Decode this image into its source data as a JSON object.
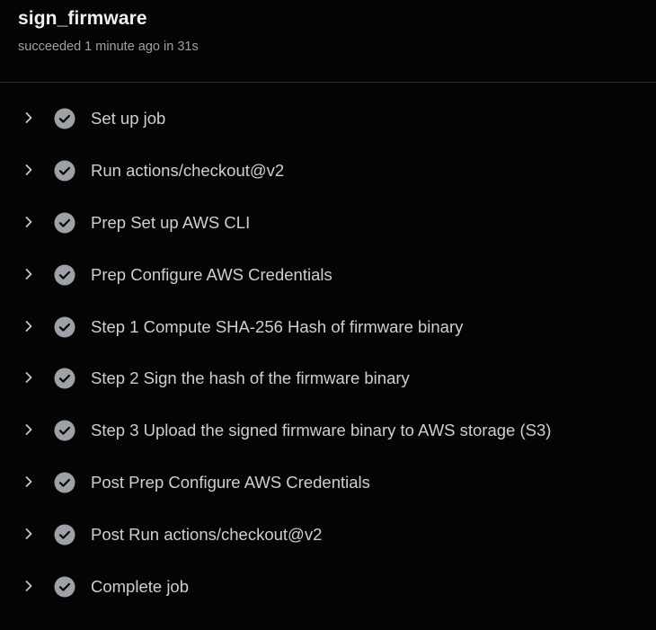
{
  "job": {
    "title": "sign_firmware",
    "status": "succeeded 1 minute ago in 31s"
  },
  "steps": [
    {
      "label": "Set up job",
      "status": "success"
    },
    {
      "label": "Run actions/checkout@v2",
      "status": "success"
    },
    {
      "label": "Prep Set up AWS CLI",
      "status": "success"
    },
    {
      "label": "Prep Configure AWS Credentials",
      "status": "success"
    },
    {
      "label": "Step 1 Compute SHA-256 Hash of firmware binary",
      "status": "success"
    },
    {
      "label": "Step 2 Sign the hash of the firmware binary",
      "status": "success"
    },
    {
      "label": "Step 3 Upload the signed firmware binary to AWS storage (S3)",
      "status": "success"
    },
    {
      "label": "Post Prep Configure AWS Credentials",
      "status": "success"
    },
    {
      "label": "Post Run actions/checkout@v2",
      "status": "success"
    },
    {
      "label": "Complete job",
      "status": "success"
    }
  ],
  "icons": {
    "expand": "chevron-right-icon",
    "success": "check-circle-icon"
  },
  "colors": {
    "background": "#050505",
    "success_icon": "#9ea2a7"
  }
}
